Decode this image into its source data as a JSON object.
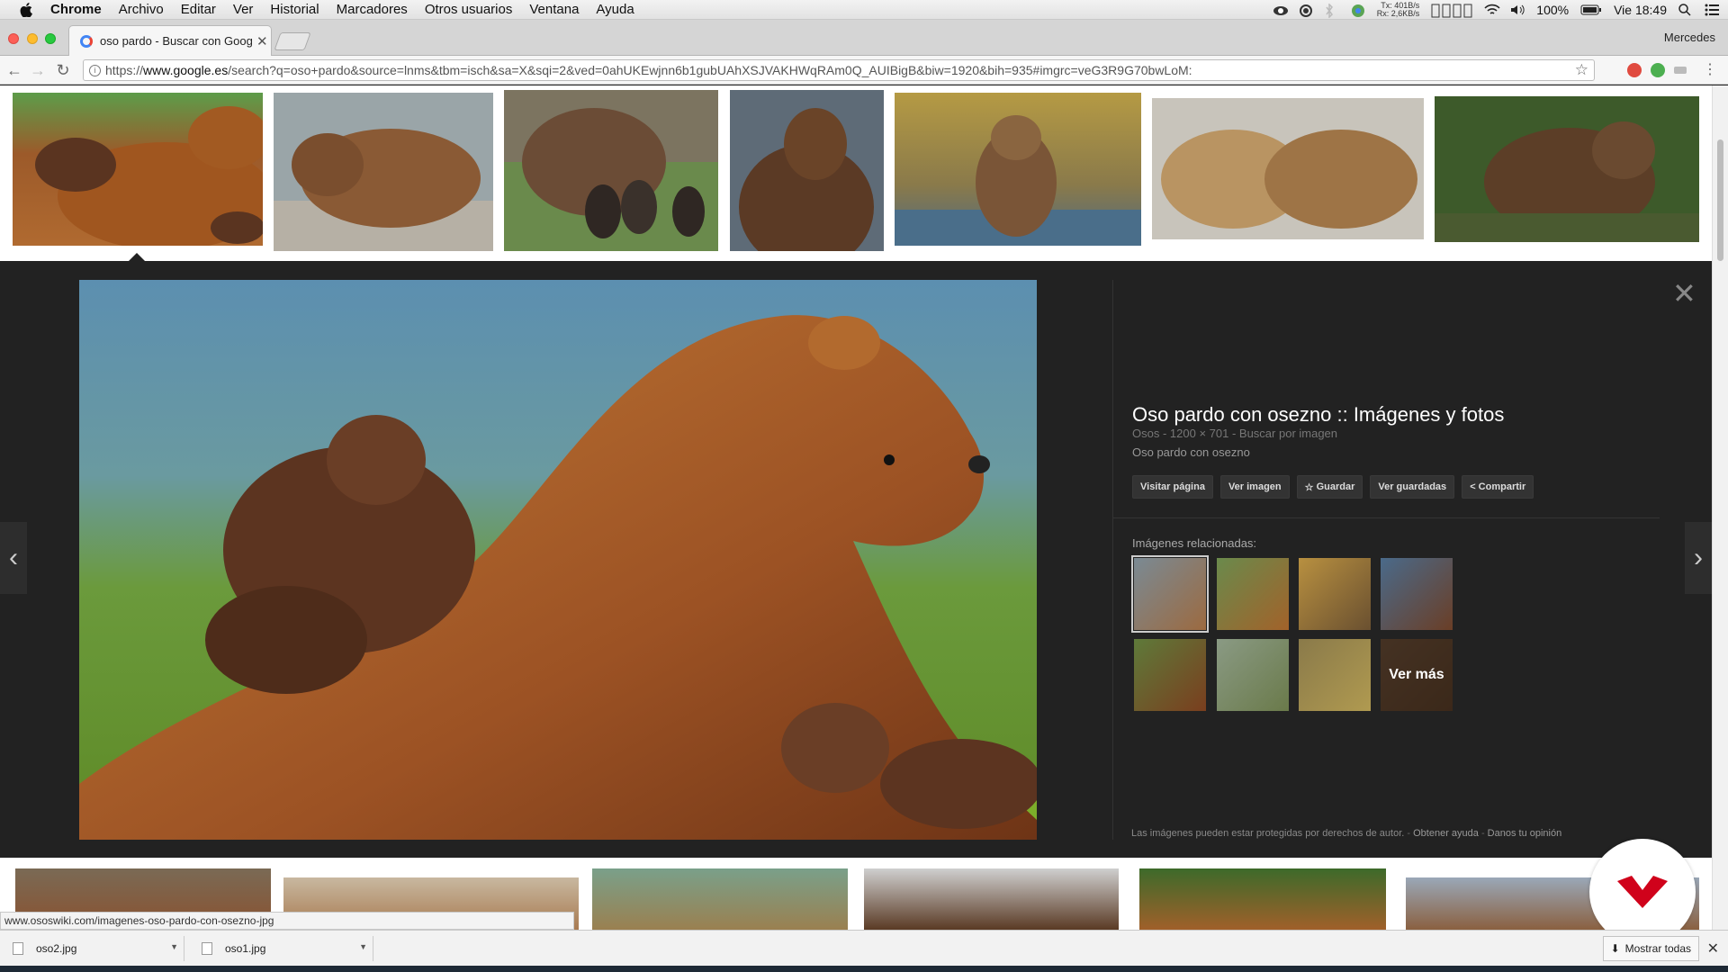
{
  "menubar": {
    "items": [
      "Chrome",
      "Archivo",
      "Editar",
      "Ver",
      "Historial",
      "Marcadores",
      "Otros usuarios",
      "Ventana",
      "Ayuda"
    ],
    "net_tx": "401B/s",
    "net_rx": "2,6KB/s",
    "net_tx_label": "Tx:",
    "net_rx_label": "Rx:",
    "battery": "100%",
    "clock": "Vie 18:49"
  },
  "browser": {
    "tab_title": "oso pardo - Buscar con Google",
    "profile": "Mercedes",
    "url_prefix": "https://",
    "url_host": "www.google.es",
    "url_rest": "/search?q=oso+pardo&source=lnms&tbm=isch&sa=X&sqi=2&ved=0ahUKEwjnn6b1gubUAhXSJVAKHWqRAm0Q_AUIBigB&biw=1920&bih=935#imgrc=veG3R9G70bwLoM:"
  },
  "viewer": {
    "title": "Oso pardo con osezno :: Imágenes y fotos",
    "meta_site": "Osos",
    "meta_size": "1200 × 701",
    "meta_search": "Buscar por imagen",
    "description": "Oso pardo con osezno",
    "actions": [
      "Visitar página",
      "Ver imagen",
      "Guardar",
      "Ver guardadas",
      "Compartir"
    ],
    "related_label": "Imágenes relacionadas:",
    "ver_mas": "Ver más",
    "footnote": "Las imágenes pueden estar protegidas por derechos de autor.",
    "help_link": "Obtener ayuda",
    "feedback_link": "Danos tu opinión"
  },
  "status_url": "www.ososwiki.com/imagenes-oso-pardo-con-osezno-jpg",
  "downloads": {
    "files": [
      "oso2.jpg",
      "oso1.jpg"
    ],
    "show_all": "Mostrar todas"
  },
  "colors": {
    "viewer_bg": "#222222",
    "logo_red": "#d0021b"
  }
}
